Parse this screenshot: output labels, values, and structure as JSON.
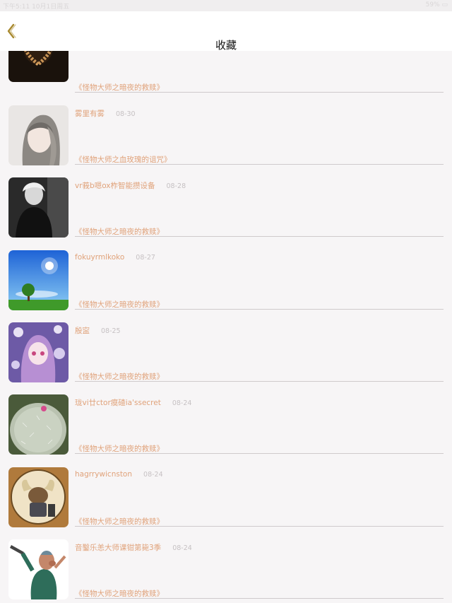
{
  "status_bar": {
    "left": "下午5:11  10月1日周五",
    "right": "59% ▭"
  },
  "nav": {
    "title": "收藏",
    "back_icon": "chevron-left-icon"
  },
  "colors": {
    "accent": "#e0a27a",
    "date": "#c6c1c3",
    "divider": "#cfcacc",
    "back": "#a8892e"
  },
  "items": [
    {
      "user": "",
      "date": "",
      "title": "《怪物大师之暗夜的救赎》",
      "thumb": "heart-candles"
    },
    {
      "user": "雾里有雾",
      "date": "08-30",
      "title": "《怪物大师之血玫瑰的诅咒》",
      "thumb": "anime-girl-grey"
    },
    {
      "user": "vr莪b嗯ox柞智能攒设备",
      "date": "08-28",
      "title": "《怪物大师之暗夜的救赎》",
      "thumb": "bw-portrait"
    },
    {
      "user": "fokuyrmlkoko",
      "date": "08-27",
      "title": "《怪物大师之暗夜的救赎》",
      "thumb": "sky-tree"
    },
    {
      "user": "殷寍",
      "date": "08-25",
      "title": "《怪物大师之暗夜的救赎》",
      "thumb": "anime-girl-flowers"
    },
    {
      "user": "珑vi廿ctor瘼碴ia'ssecret",
      "date": "08-24",
      "title": "《怪物大师之暗夜的救赎》",
      "thumb": "cactus"
    },
    {
      "user": "hagrrywicnston",
      "date": "08-24",
      "title": "《怪物大师之暗夜的救赎》",
      "thumb": "viking-badge"
    },
    {
      "user": "音鑿乐恙大师课钳第毙3季",
      "date": "08-24",
      "title": "《怪物大师之暗夜的救赎》",
      "thumb": "cartoon-man"
    }
  ]
}
